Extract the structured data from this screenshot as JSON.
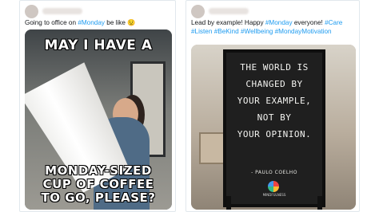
{
  "left_tweet": {
    "text_before": "Going to office on ",
    "hashtag": "#Monday",
    "text_after": " be like ",
    "emoji": "😟",
    "meme": {
      "top_caption": "MAY I HAVE A",
      "bottom_caption_line1": "MONDAY-SIZED",
      "bottom_caption_line2": "CUP OF COFFEE",
      "bottom_caption_line3": "TO GO, PLEASE?"
    }
  },
  "right_tweet": {
    "line1_plain_a": "Lead by example! Happy ",
    "line1_tag1": "#Monday",
    "line1_plain_b": " everyone! ",
    "line1_tag2": "#Care",
    "line2_tag1": "#Listen",
    "line2_tag2": "#BeKind",
    "line2_tag3": "#Wellbeing",
    "line2_tag4": "#MondayMotivation",
    "board": {
      "line1": "THE WORLD IS",
      "line2": "CHANGED BY",
      "line3": "YOUR EXAMPLE,",
      "line4": "NOT BY",
      "line5": "YOUR OPINION.",
      "author": "- PAULO COELHO",
      "logo_text": "MINDFULNESS"
    }
  },
  "colors": {
    "hashtag": "#1d9bf0",
    "text": "#14171a"
  }
}
